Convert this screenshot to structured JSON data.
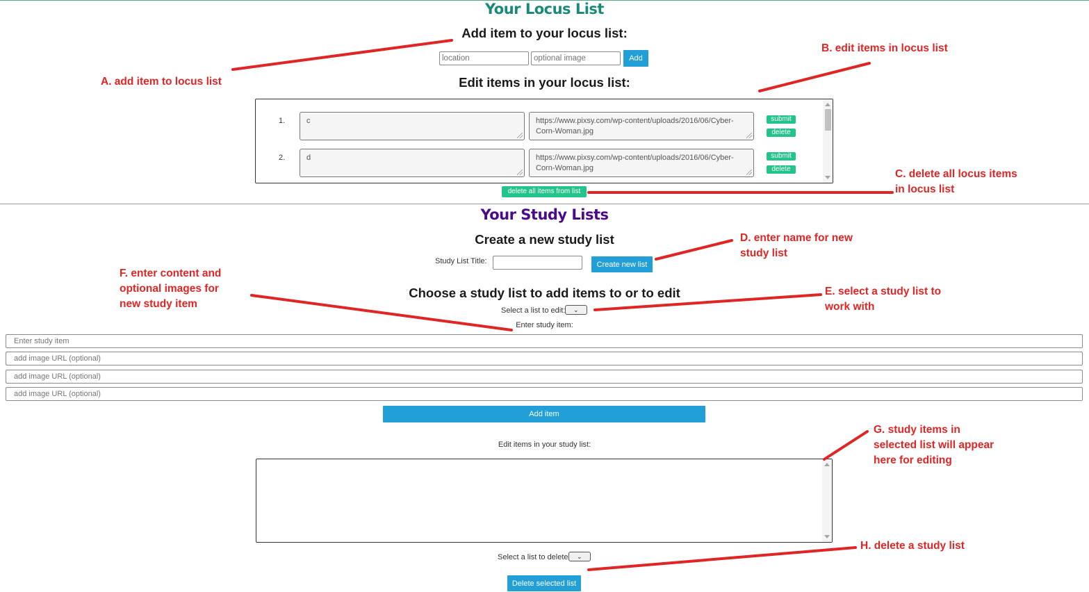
{
  "locus": {
    "title": "Your Locus List",
    "add_heading": "Add item to your locus list:",
    "location_placeholder": "location",
    "image_placeholder": "optional image",
    "add_button": "Add",
    "edit_heading": "Edit items in your locus list:",
    "items": [
      {
        "num": "1.",
        "text": "c",
        "url": "https://www.pixsy.com/wp-content/uploads/2016/06/Cyber-Corn-Woman.jpg",
        "submit": "submit",
        "delete": "delete"
      },
      {
        "num": "2.",
        "text": "d",
        "url": "https://www.pixsy.com/wp-content/uploads/2016/06/Cyber-Corn-Woman.jpg",
        "submit": "submit",
        "delete": "delete"
      }
    ],
    "delete_all_button": "delete all items from list"
  },
  "study": {
    "title": "Your Study Lists",
    "create_heading": "Create a new study list",
    "title_label": "Study List Title:",
    "create_button": "Create new list",
    "choose_heading": "Choose a study list to add items to or to edit",
    "select_edit_label": "Select a list to edit:",
    "enter_item_label": "Enter study item:",
    "item_placeholder": "Enter study item",
    "image_placeholders": [
      "add image URL (optional)",
      "add image URL (optional)",
      "add image URL (optional)"
    ],
    "add_item_button": "Add item",
    "edit_label": "Edit items in your study list:",
    "select_delete_label": "Select a list to delete:",
    "delete_button": "Delete selected list"
  },
  "annotations": {
    "a": [
      "A. add item to locus list"
    ],
    "b": [
      "B. edit items in locus list"
    ],
    "c": [
      "C. delete all locus items",
      "in locus list"
    ],
    "d": [
      "D. enter name for new",
      "study list"
    ],
    "e": [
      "E. select a study list to",
      "work with"
    ],
    "f": [
      "F. enter content and",
      "optional images for",
      "new study item"
    ],
    "g": [
      "G. study items in",
      "selected list will appear",
      "here for editing"
    ],
    "h": [
      "H. delete a study list"
    ]
  },
  "colors": {
    "locus_title": "#1a8a78",
    "study_title": "#4b0a8a",
    "annotation": "#e02525",
    "blue_button": "#229fd6",
    "green_button": "#22c48a"
  }
}
